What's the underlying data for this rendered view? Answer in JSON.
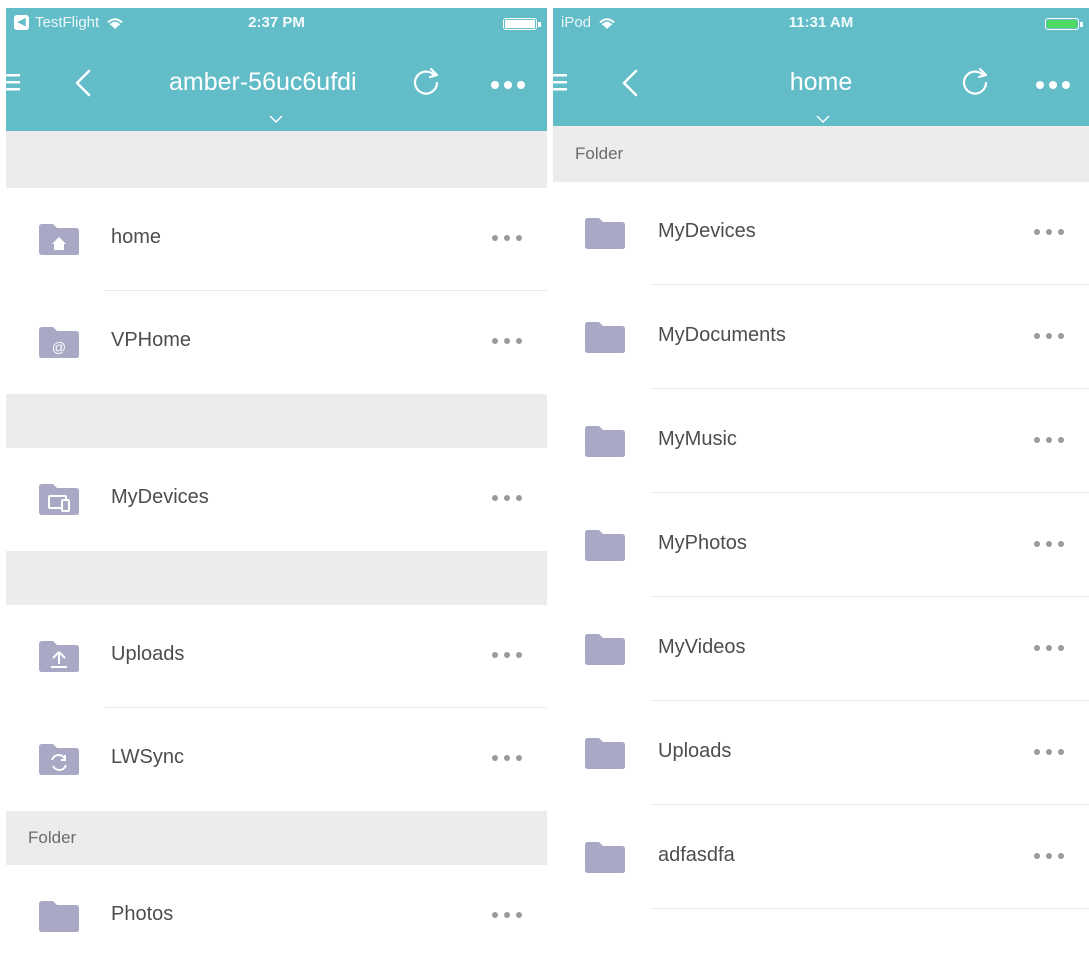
{
  "left": {
    "status": {
      "carrier": "TestFlight",
      "time": "2:37 PM"
    },
    "nav": {
      "title": "amber-56uc6ufdi"
    },
    "rows": [
      {
        "label": "home",
        "icon": "home-folder-icon"
      },
      {
        "label": "VPHome",
        "icon": "at-folder-icon"
      },
      {
        "label": "MyDevices",
        "icon": "devices-folder-icon"
      },
      {
        "label": "Uploads",
        "icon": "upload-folder-icon"
      },
      {
        "label": "LWSync",
        "icon": "sync-folder-icon"
      },
      {
        "label": "Photos",
        "icon": "folder-icon"
      }
    ],
    "section_label": "Folder"
  },
  "right": {
    "status": {
      "carrier": "iPod",
      "time": "11:31 AM"
    },
    "nav": {
      "title": "home"
    },
    "section_label": "Folder",
    "rows": [
      {
        "label": "MyDevices",
        "icon": "folder-icon"
      },
      {
        "label": "MyDocuments",
        "icon": "folder-icon"
      },
      {
        "label": "MyMusic",
        "icon": "folder-icon"
      },
      {
        "label": "MyPhotos",
        "icon": "folder-icon"
      },
      {
        "label": "MyVideos",
        "icon": "folder-icon"
      },
      {
        "label": "Uploads",
        "icon": "folder-icon"
      },
      {
        "label": "adfasdfa",
        "icon": "folder-icon"
      }
    ]
  },
  "colors": {
    "header": "#63bdc9",
    "folder_icon": "#a9a9c6",
    "section_bg": "#ececec"
  }
}
